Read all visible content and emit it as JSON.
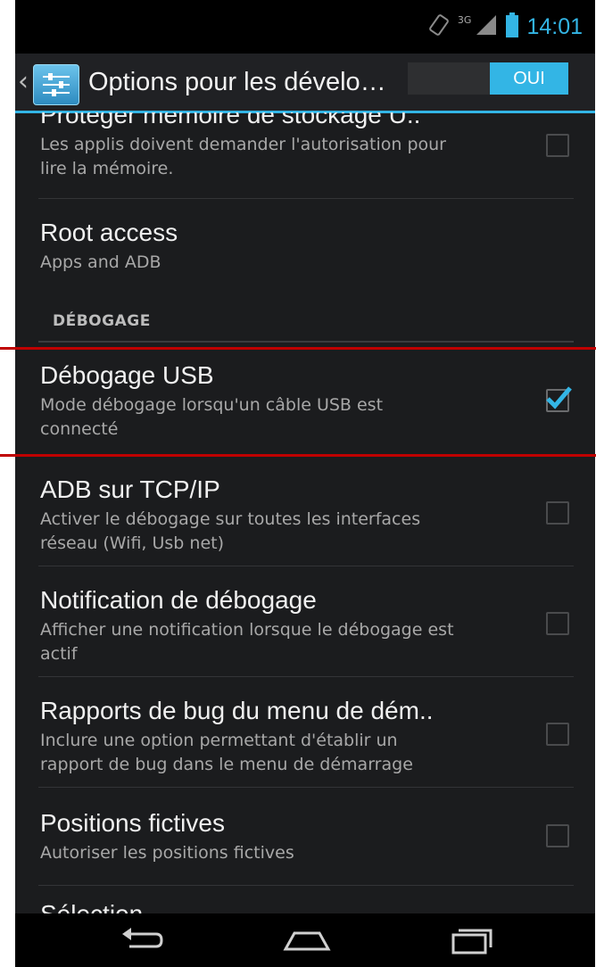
{
  "status_bar": {
    "time": "14:01",
    "network_type": "3G"
  },
  "action_bar": {
    "title": "Options pour les dévelo…",
    "toggle_label": "OUI",
    "toggle_state": "on"
  },
  "preferences_before_section": [
    {
      "title": "Protéger mémoire de stockage U..",
      "summary": "Les applis doivent demander l'autorisation pour lire la mémoire.",
      "checked": false
    },
    {
      "title": "Root access",
      "summary": "Apps and ADB"
    }
  ],
  "section": {
    "header": "DÉBOGAGE"
  },
  "preferences_debug": [
    {
      "title": "Débogage USB",
      "summary": "Mode débogage lorsqu'un câble USB est connecté",
      "checked": true
    },
    {
      "title": "ADB sur TCP/IP",
      "summary": "Activer le débogage sur toutes les interfaces réseau (Wifi, Usb net)",
      "checked": false
    },
    {
      "title": "Notification de débogage",
      "summary": "Afficher une notification lorsque le débogage est actif",
      "checked": false
    },
    {
      "title": "Rapports de bug du menu de dém..",
      "summary": "Inclure une option permettant d'établir un rapport de bug dans le menu de démarrage",
      "checked": false
    },
    {
      "title": "Positions fictives",
      "summary": "Autoriser les positions fictives",
      "checked": false
    },
    {
      "title": "Sélection…"
    }
  ],
  "colors": {
    "accent": "#33b5e5",
    "highlight": "#c00000",
    "background": "#1b1c1e"
  },
  "nav_bar": {
    "icons": [
      "back-icon",
      "home-icon",
      "recent-apps-icon"
    ]
  }
}
